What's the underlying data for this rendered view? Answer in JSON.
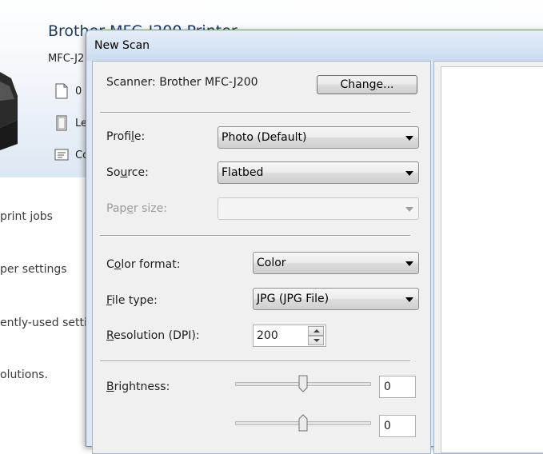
{
  "background_window": {
    "title": "Brother MFC-J200 Printer",
    "model": "MFC-J2",
    "rows": [
      {
        "text": "0",
        "icon": "document-icon"
      },
      {
        "text": "Le",
        "icon": "paper-icon"
      },
      {
        "text": "Co",
        "icon": "list-icon"
      }
    ],
    "links": [
      "print jobs",
      "per settings",
      "ently-used settin",
      "olutions."
    ]
  },
  "dialog": {
    "title": "New Scan",
    "scanner_label": "Scanner: Brother MFC-J200",
    "change_button": {
      "pre": "Chan",
      "mnemonic": "g",
      "post": "e..."
    },
    "profile": {
      "label_pre": "Profi",
      "label_mnemonic": "l",
      "label_post": "e:",
      "value": "Photo (Default)"
    },
    "source": {
      "label_pre": "So",
      "label_mnemonic": "u",
      "label_post": "rce:",
      "value": "Flatbed"
    },
    "paper_size": {
      "label_pre": "Pap",
      "label_mnemonic": "e",
      "label_post": "r size:",
      "value": ""
    },
    "color_format": {
      "label_pre": "C",
      "label_mnemonic": "o",
      "label_post": "lor format:",
      "value": "Color"
    },
    "file_type": {
      "label_pre": "",
      "label_mnemonic": "F",
      "label_post": "ile type:",
      "value": "JPG (JPG File)"
    },
    "resolution": {
      "label_pre": "",
      "label_mnemonic": "R",
      "label_post": "esolution (DPI):",
      "value": "200"
    },
    "brightness": {
      "label_pre": "",
      "label_mnemonic": "B",
      "label_post": "rightness:",
      "value": "0",
      "level": 0
    },
    "contrast": {
      "value": "0",
      "level": 0
    }
  },
  "colors": {
    "dialog_frame": "#dce8f5",
    "panel": "#f0f0f0",
    "disabled_text": "#9a9a9a"
  }
}
